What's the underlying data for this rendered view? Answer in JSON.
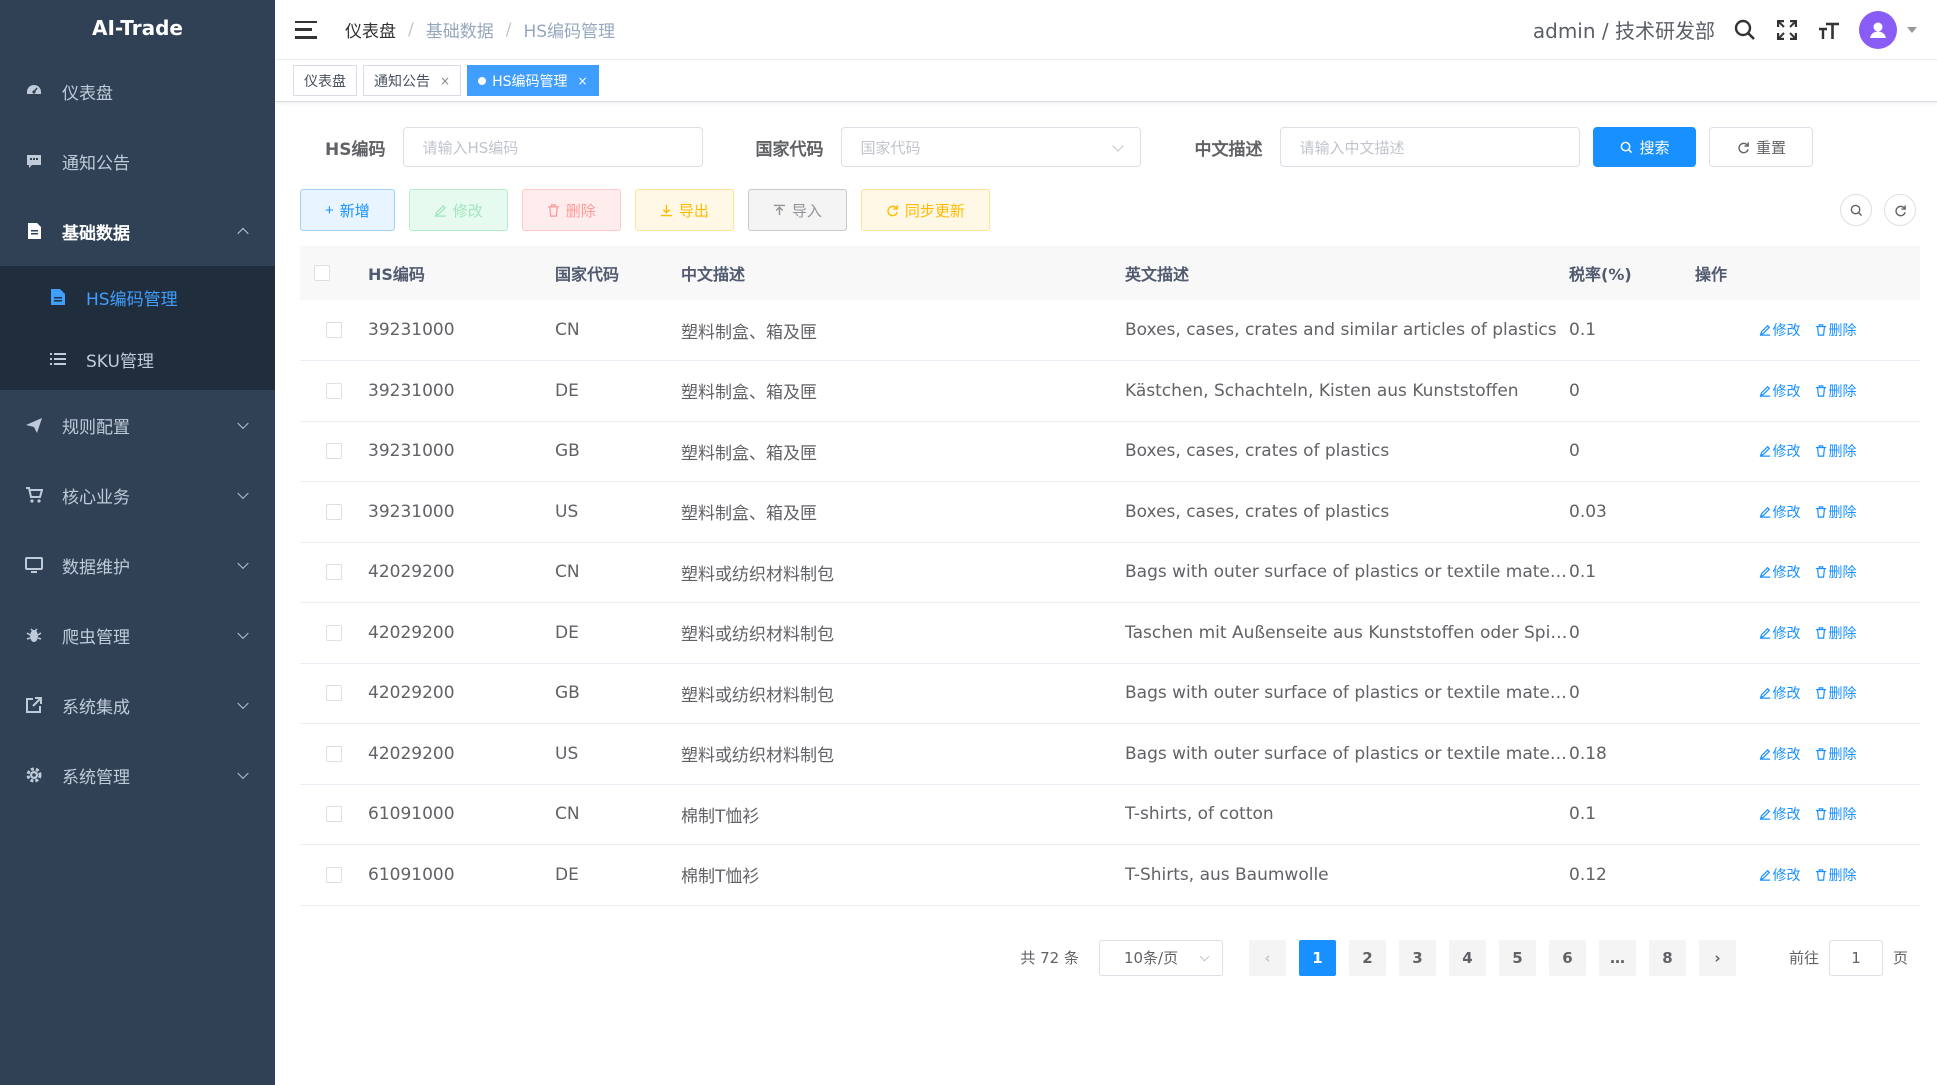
{
  "app": {
    "title": "AI-Trade"
  },
  "sidebar": {
    "items": [
      {
        "label": "仪表盘",
        "icon": "dashboard-icon"
      },
      {
        "label": "通知公告",
        "icon": "message-icon"
      },
      {
        "label": "基础数据",
        "icon": "document-icon",
        "expanded": true,
        "children": [
          {
            "label": "HS编码管理",
            "icon": "file-icon",
            "active": true
          },
          {
            "label": "SKU管理",
            "icon": "list-icon"
          }
        ]
      },
      {
        "label": "规则配置",
        "icon": "send-icon"
      },
      {
        "label": "核心业务",
        "icon": "cart-icon"
      },
      {
        "label": "数据维护",
        "icon": "monitor-icon"
      },
      {
        "label": "爬虫管理",
        "icon": "bug-icon"
      },
      {
        "label": "系统集成",
        "icon": "external-link-icon"
      },
      {
        "label": "系统管理",
        "icon": "gear-icon"
      }
    ]
  },
  "navbar": {
    "breadcrumb": [
      "仪表盘",
      "基础数据",
      "HS编码管理"
    ],
    "user": "admin / 技术研发部"
  },
  "tags": [
    {
      "label": "仪表盘",
      "closable": false,
      "active": false
    },
    {
      "label": "通知公告",
      "closable": true,
      "active": false
    },
    {
      "label": "HS编码管理",
      "closable": true,
      "active": true
    }
  ],
  "search": {
    "hs_label": "HS编码",
    "hs_placeholder": "请输入HS编码",
    "country_label": "国家代码",
    "country_placeholder": "国家代码",
    "desc_label": "中文描述",
    "desc_placeholder": "请输入中文描述",
    "search_btn": "搜索",
    "reset_btn": "重置"
  },
  "toolbar": {
    "add": "新增",
    "edit": "修改",
    "delete": "删除",
    "export": "导出",
    "import": "导入",
    "sync": "同步更新"
  },
  "table": {
    "headers": [
      "HS编码",
      "国家代码",
      "中文描述",
      "英文描述",
      "税率(%)",
      "操作"
    ],
    "edit_label": "修改",
    "delete_label": "删除",
    "rows": [
      [
        "39231000",
        "CN",
        "塑料制盒、箱及匣",
        "Boxes, cases, crates and similar articles of plastics",
        "0.1"
      ],
      [
        "39231000",
        "DE",
        "塑料制盒、箱及匣",
        "Kästchen, Schachteln, Kisten aus Kunststoffen",
        "0"
      ],
      [
        "39231000",
        "GB",
        "塑料制盒、箱及匣",
        "Boxes, cases, crates of plastics",
        "0"
      ],
      [
        "39231000",
        "US",
        "塑料制盒、箱及匣",
        "Boxes, cases, crates of plastics",
        "0.03"
      ],
      [
        "42029200",
        "CN",
        "塑料或纺织材料制包",
        "Bags with outer surface of plastics or textile materials",
        "0.1"
      ],
      [
        "42029200",
        "DE",
        "塑料或纺织材料制包",
        "Taschen mit Außenseite aus Kunststoffen oder Spinnstoffen",
        "0"
      ],
      [
        "42029200",
        "GB",
        "塑料或纺织材料制包",
        "Bags with outer surface of plastics or textile materials",
        "0"
      ],
      [
        "42029200",
        "US",
        "塑料或纺织材料制包",
        "Bags with outer surface of plastics or textile materials",
        "0.18"
      ],
      [
        "61091000",
        "CN",
        "棉制T恤衫",
        "T-shirts, of cotton",
        "0.1"
      ],
      [
        "61091000",
        "DE",
        "棉制T恤衫",
        "T-Shirts, aus Baumwolle",
        "0.12"
      ]
    ]
  },
  "pagination": {
    "total": "共 72 条",
    "page_size": "10条/页",
    "pages": [
      "1",
      "2",
      "3",
      "4",
      "5",
      "6",
      "…",
      "8"
    ],
    "current": "1",
    "goto_prefix": "前往",
    "goto_value": "1",
    "goto_suffix": "页"
  },
  "colors": {
    "sidebar_bg": "#304156",
    "submenu_bg": "#1f2d3d",
    "primary": "#1890ff",
    "avatar": "#8a5cf6"
  }
}
